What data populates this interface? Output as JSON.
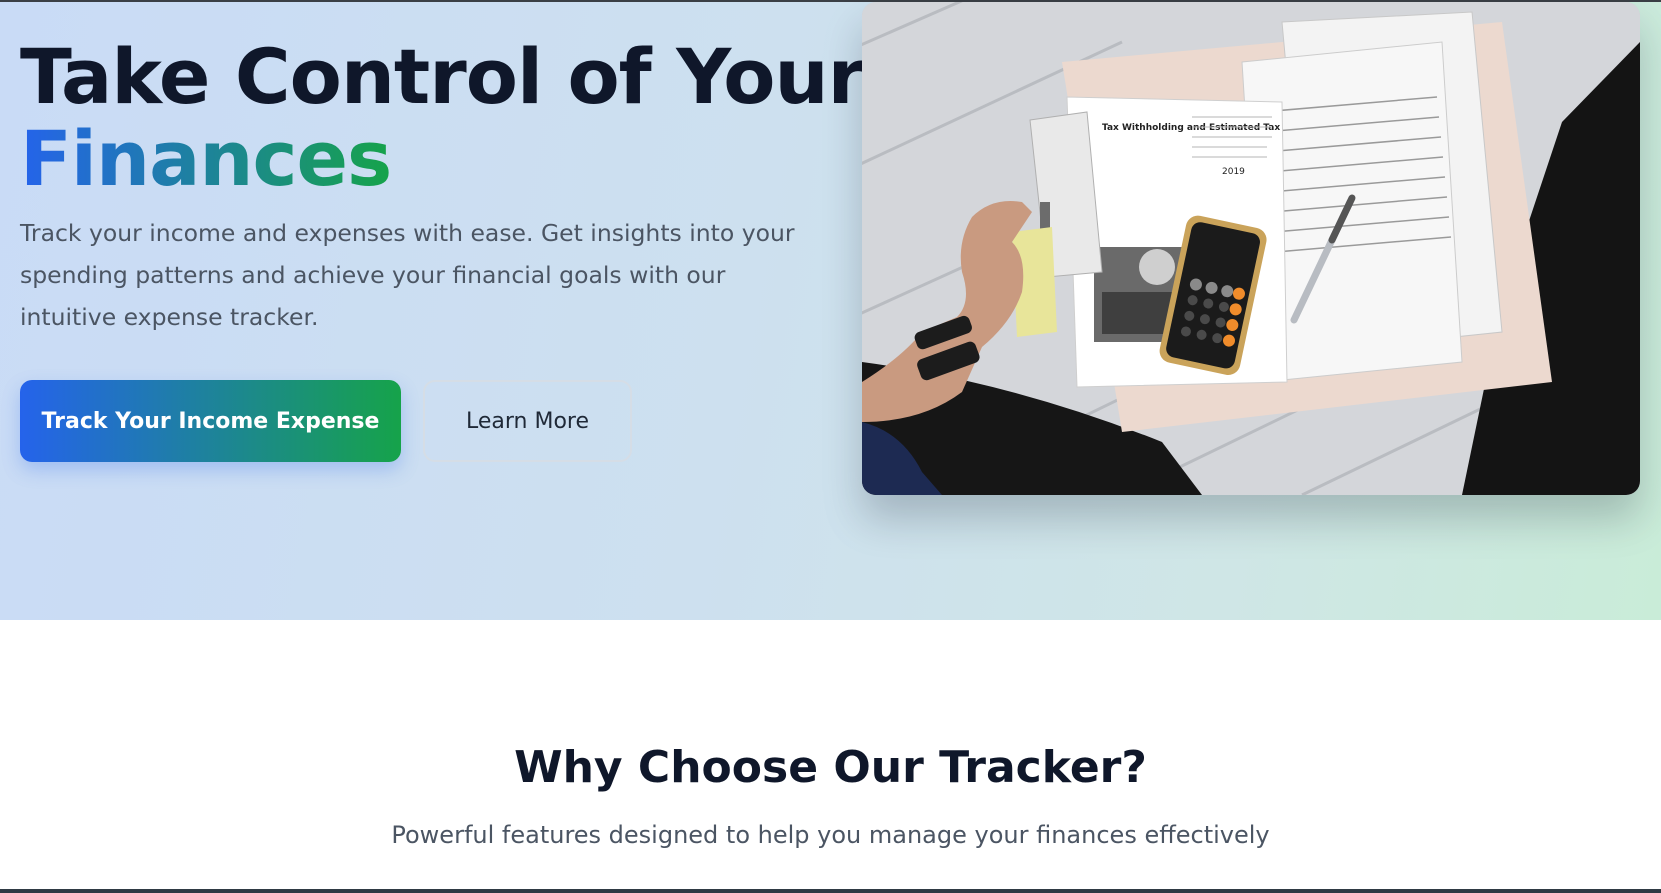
{
  "hero": {
    "title_line1": "Take Control of Your",
    "title_line2": "Finances",
    "description": "Track your income and expenses with ease. Get insights into your spending patterns and achieve your financial goals with our intuitive expense tracker.",
    "primary_button": "Track Your Income Expense",
    "secondary_button": "Learn More",
    "image": {
      "form_title": "Tax Withholding and Estimated Tax",
      "form_year": "2019"
    }
  },
  "features": {
    "title": "Why Choose Our Tracker?",
    "subtitle": "Powerful features designed to help you manage your finances effectively"
  },
  "colors": {
    "gradient_start": "#2563eb",
    "gradient_end": "#16a34a",
    "heading": "#0f172a",
    "body_text": "#4b5563"
  }
}
